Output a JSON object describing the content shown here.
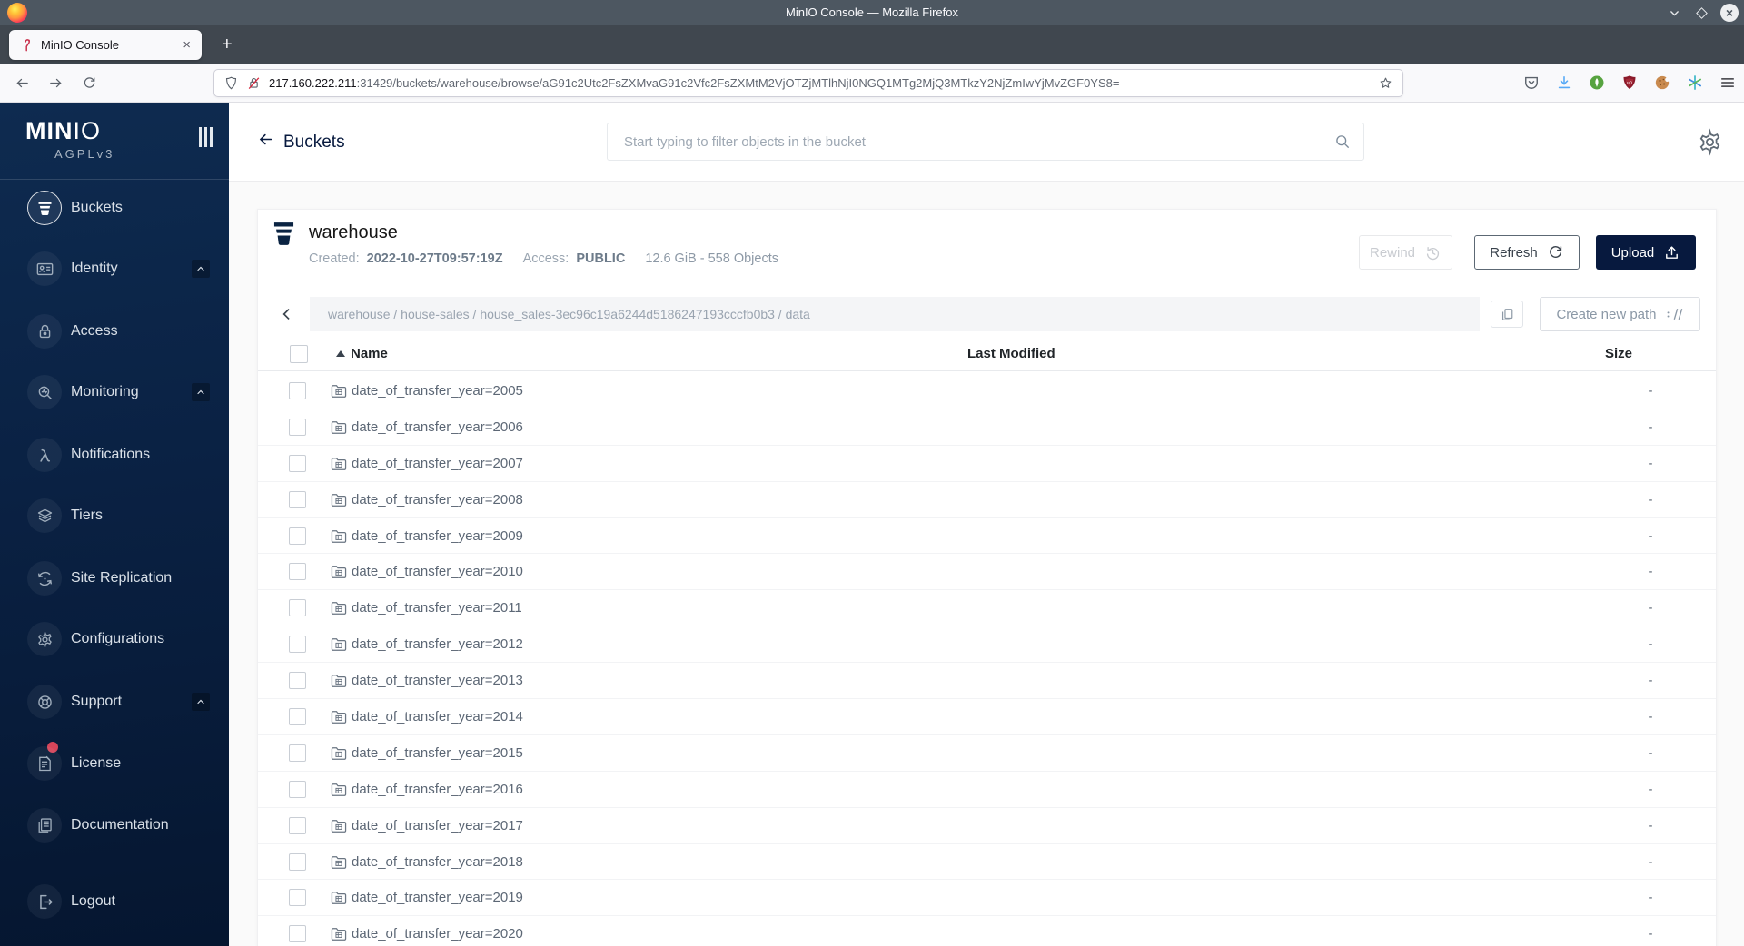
{
  "browser": {
    "window_title": "MinIO Console — Mozilla Firefox",
    "tab_title": "MinIO Console",
    "url": {
      "host": "217.160.222.211",
      "rest": ":31429/buckets/warehouse/browse/aG91c2Utc2FsZXMvaG91c2Vfc2FsZXMtM2VjOTZjMTlhNjI0NGQ1MTg2MjQ3MTkzY2NjZmIwYjMvZGF0YS8="
    }
  },
  "sidebar": {
    "logo_text": "MINIO",
    "logo_sub": "AGPLv3",
    "items": [
      {
        "label": "Buckets",
        "icon": "bucket-icon",
        "selected": true
      },
      {
        "label": "Identity",
        "icon": "identity-card-icon",
        "expandable": true
      },
      {
        "label": "Access",
        "icon": "lock-icon"
      },
      {
        "label": "Monitoring",
        "icon": "monitoring-search-icon",
        "expandable": true
      },
      {
        "label": "Notifications",
        "icon": "lambda-icon"
      },
      {
        "label": "Tiers",
        "icon": "tiers-layers-icon"
      },
      {
        "label": "Site Replication",
        "icon": "replication-icon"
      },
      {
        "label": "Configurations",
        "icon": "gear-icon"
      },
      {
        "label": "Support",
        "icon": "support-lifebuoy-icon",
        "expandable": true
      },
      {
        "label": "License",
        "icon": "license-document-icon",
        "badge": true
      },
      {
        "label": "Documentation",
        "icon": "documentation-icon"
      },
      {
        "label": "Logout",
        "icon": "logout-icon"
      }
    ]
  },
  "header": {
    "back_label": "Buckets",
    "search_placeholder": "Start typing to filter objects in the bucket"
  },
  "bucket": {
    "name": "warehouse",
    "created_label": "Created:",
    "created_value": "2022-10-27T09:57:19Z",
    "access_label": "Access:",
    "access_value": "PUBLIC",
    "usage": "12.6 GiB - 558 Objects",
    "actions": {
      "rewind": "Rewind",
      "refresh": "Refresh",
      "upload": "Upload"
    }
  },
  "browse": {
    "breadcrumb": "warehouse / house-sales / house_sales-3ec96c19a6244d5186247193cccfb0b3 / data",
    "create_path_label": "Create new path"
  },
  "table": {
    "columns": {
      "name": "Name",
      "last_modified": "Last Modified",
      "size": "Size"
    },
    "rows": [
      {
        "name": "date_of_transfer_year=2005",
        "size": "-"
      },
      {
        "name": "date_of_transfer_year=2006",
        "size": "-"
      },
      {
        "name": "date_of_transfer_year=2007",
        "size": "-"
      },
      {
        "name": "date_of_transfer_year=2008",
        "size": "-"
      },
      {
        "name": "date_of_transfer_year=2009",
        "size": "-"
      },
      {
        "name": "date_of_transfer_year=2010",
        "size": "-"
      },
      {
        "name": "date_of_transfer_year=2011",
        "size": "-"
      },
      {
        "name": "date_of_transfer_year=2012",
        "size": "-"
      },
      {
        "name": "date_of_transfer_year=2013",
        "size": "-"
      },
      {
        "name": "date_of_transfer_year=2014",
        "size": "-"
      },
      {
        "name": "date_of_transfer_year=2015",
        "size": "-"
      },
      {
        "name": "date_of_transfer_year=2016",
        "size": "-"
      },
      {
        "name": "date_of_transfer_year=2017",
        "size": "-"
      },
      {
        "name": "date_of_transfer_year=2018",
        "size": "-"
      },
      {
        "name": "date_of_transfer_year=2019",
        "size": "-"
      },
      {
        "name": "date_of_transfer_year=2020",
        "size": "-"
      }
    ]
  },
  "colors": {
    "brand_navy": "#081C42",
    "button_navy": "#07193E",
    "badge_red": "#d6455a",
    "download_blue": "#57a9f6"
  }
}
